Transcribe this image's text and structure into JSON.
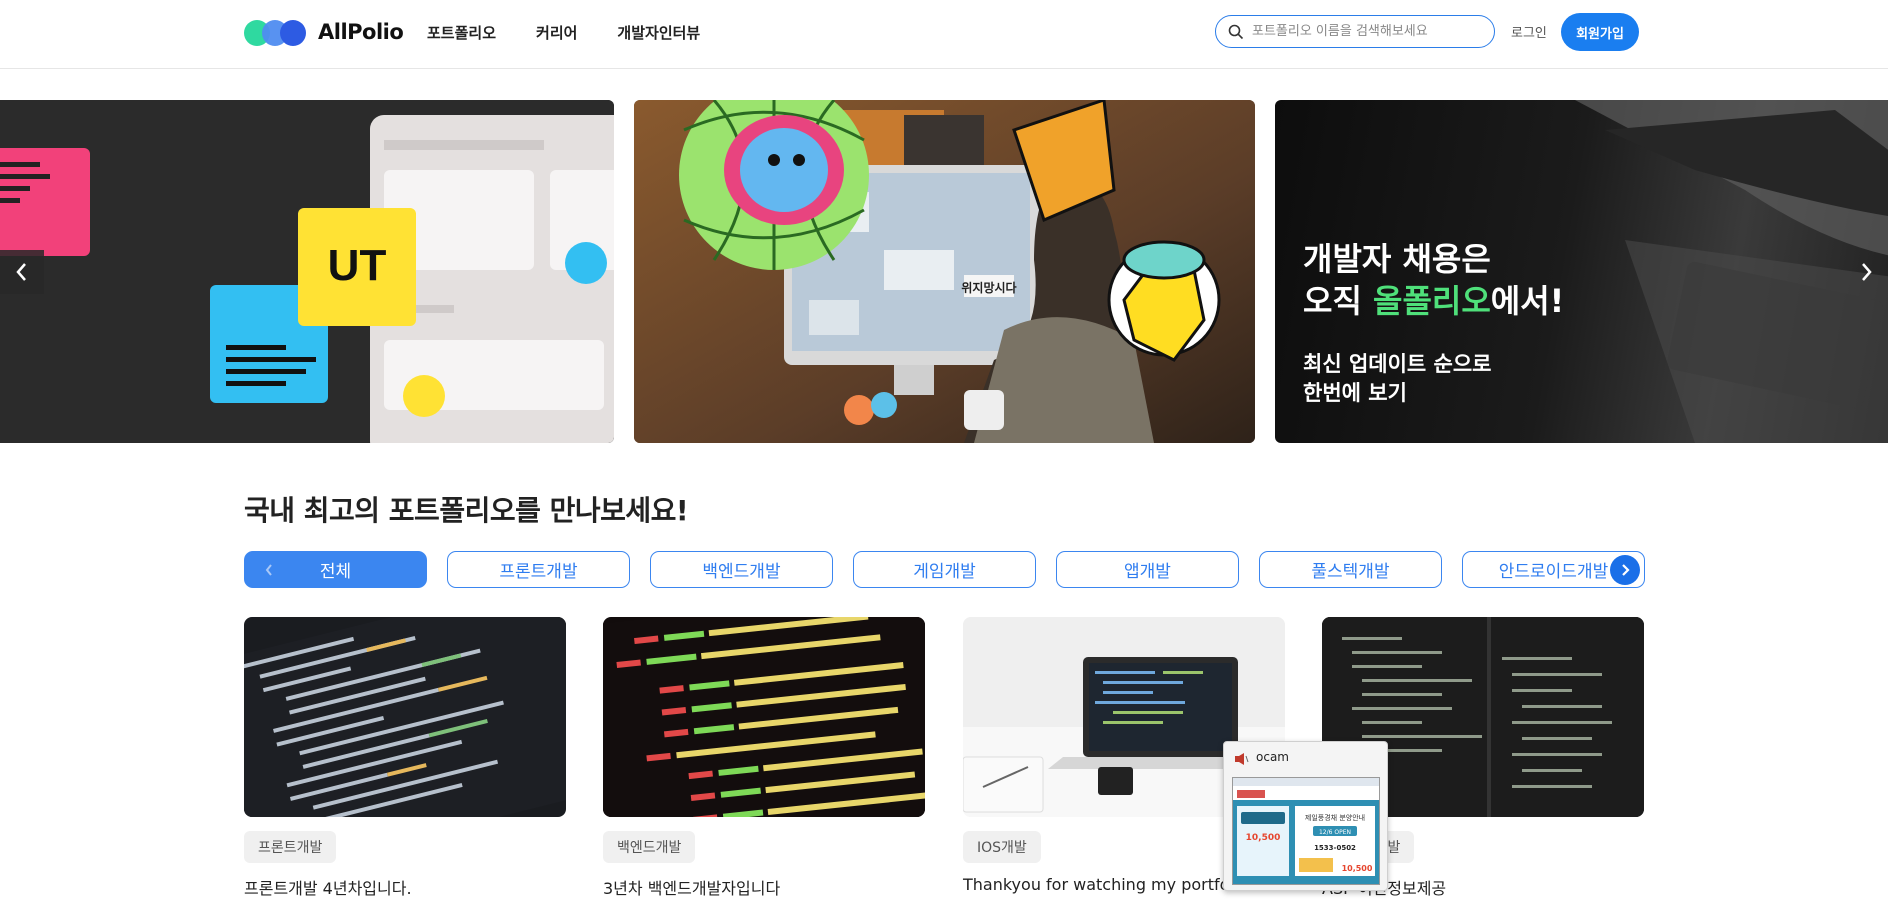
{
  "header": {
    "logo_text": "AllPolio",
    "nav": [
      "포트폴리오",
      "커리어",
      "개발자인터뷰"
    ],
    "search_placeholder": "포트폴리오 이름을 검색해보세요",
    "login": "로그인",
    "signup": "회원가입"
  },
  "hero": {
    "slide1_badge": "UT",
    "slide2_sign": "위지망시다",
    "slide3_line1": "개발자 채용은",
    "slide3_line2_pre": "오직 ",
    "slide3_line2_hl": "올폴리오",
    "slide3_line2_post": "에서!",
    "slide3_sub1": "최신 업데이트 순으로",
    "slide3_sub2": "한번에 보기",
    "accent_color": "#4fe07a"
  },
  "section": {
    "title": "국내 최고의 포트폴리오를 만나보세요!",
    "chips": [
      "전체",
      "프론트개발",
      "백엔드개발",
      "게임개발",
      "앱개발",
      "풀스텍개발",
      "안드로이드개발"
    ],
    "active_chip": "전체"
  },
  "cards": [
    {
      "tag": "프론트개발",
      "title": "프론트개발 4년차입니다."
    },
    {
      "tag": "백엔드개발",
      "title": "3년차 백엔드개발자입니다"
    },
    {
      "tag": "IOS개발",
      "title": "Thankyou for watching my portfolio"
    },
    {
      "tag": "백엔드개발",
      "title": "ASP 이진정보제공"
    }
  ],
  "popup": {
    "title": "ocam",
    "preview_text1": "제일풍경채 분양안내",
    "preview_text2": "12/6 OPEN",
    "preview_text3": "1533-0502",
    "preview_price": "10,500"
  },
  "colors": {
    "primary": "#1a7ef0",
    "chip": "#3b86f0"
  }
}
